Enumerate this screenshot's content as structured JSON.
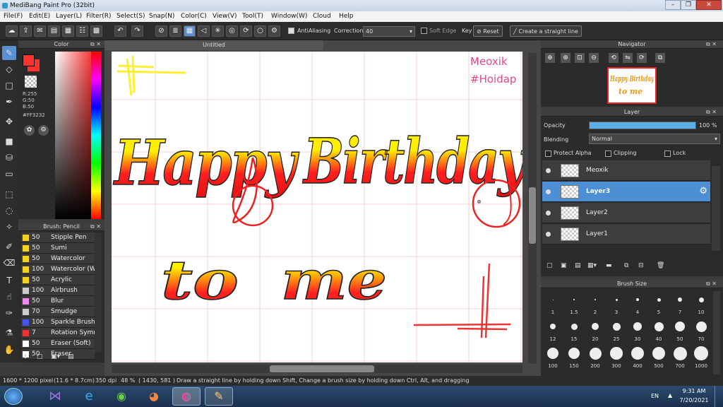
{
  "window": {
    "title": "MediBang Paint Pro (32bit)",
    "minimize": "–",
    "maximize": "❐",
    "close": "✕"
  },
  "menu": [
    "File(F)",
    "Edit(E)",
    "Layer(L)",
    "Filter(R)",
    "Select(S)",
    "Snap(N)",
    "Color(C)",
    "View(V)",
    "Tool(T)",
    "Window(W)",
    "Cloud",
    "Help"
  ],
  "toolbar": {
    "antialiasing": "AntiAliasing",
    "correction_label": "Correction",
    "correction_value": "40",
    "soft_edge": "Soft Edge",
    "key_label": "Key",
    "reset_label": "Reset",
    "straight_line_label": "Create a straight line"
  },
  "color_panel": {
    "title": "Color",
    "r": "R:255",
    "g": "G:50",
    "b": "B:50",
    "hex": "#FF3232",
    "primary_color": "#ff3232"
  },
  "brush_panel": {
    "title": "Brush: Pencil",
    "items": [
      {
        "size": "50",
        "name": "Stipple Pen",
        "color": "#f2d21a"
      },
      {
        "size": "50",
        "name": "Sumi",
        "color": "#f2d21a"
      },
      {
        "size": "50",
        "name": "Watercolor",
        "color": "#f2d21a"
      },
      {
        "size": "100",
        "name": "Watercolor (W",
        "color": "#f2d21a"
      },
      {
        "size": "50",
        "name": "Acrylic",
        "color": "#f2d21a"
      },
      {
        "size": "100",
        "name": "Airbrush",
        "color": "#cccccc"
      },
      {
        "size": "50",
        "name": "Blur",
        "color": "#ee88ee"
      },
      {
        "size": "70",
        "name": "Smudge",
        "color": "#cccccc"
      },
      {
        "size": "100",
        "name": "Sparkle Brush",
        "color": "#4455ee"
      },
      {
        "size": "7",
        "name": "Rotation Symm",
        "color": "#ee3333"
      },
      {
        "size": "50",
        "name": "Eraser (Soft)",
        "color": "#ffffff"
      },
      {
        "size": "50",
        "name": "Eraser",
        "color": "#ffffff"
      }
    ]
  },
  "document": {
    "tab": "Untitled",
    "watermark1": "Meoxik",
    "watermark2": "#Hoidap"
  },
  "navigator": {
    "title": "Navigator"
  },
  "layer_panel": {
    "title": "Layer",
    "opacity_label": "Opacity",
    "opacity_value": "100 %",
    "opacity_fraction": 1.0,
    "blending_label": "Blending",
    "blending_value": "Normal",
    "protect_alpha": "Protect Alpha",
    "clipping": "Clipping",
    "lock": "Lock",
    "layers": [
      {
        "name": "Meoxik",
        "selected": false
      },
      {
        "name": "Layer3",
        "selected": true
      },
      {
        "name": "Layer2",
        "selected": false
      },
      {
        "name": "Layer1",
        "selected": false
      }
    ]
  },
  "brush_size": {
    "title": "Brush Size",
    "sizes": [
      "1",
      "1.5",
      "2",
      "3",
      "4",
      "5",
      "7",
      "10",
      "12",
      "15",
      "20",
      "25",
      "30",
      "40",
      "50",
      "70",
      "100",
      "150",
      "200",
      "300",
      "400",
      "500",
      "700",
      "1000"
    ]
  },
  "status": {
    "dims": "1600 * 1200 pixel",
    "cm": "(11.6 * 8.7cm)",
    "dpi": "350 dpi",
    "zoom": "48 %",
    "coords": "( 1430, 581 )",
    "hint": "Draw a straight line by holding down Shift, Change a brush size by holding down Ctrl, Alt, and dragging"
  },
  "taskbar": {
    "lang": "EN",
    "time": "9:31 AM",
    "date": "7/20/2021"
  }
}
